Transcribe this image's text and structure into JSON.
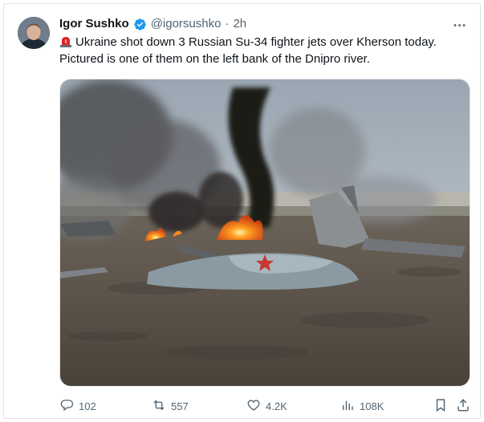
{
  "author": {
    "name": "Igor Sushko",
    "handle": "@igorsushko",
    "separator": "·",
    "time": "2h"
  },
  "icons": {
    "verified": "verified-badge-icon",
    "siren": "police-siren-emoji-icon",
    "more": "more-options-icon",
    "reply": "reply-icon",
    "repost": "repost-icon",
    "like": "like-icon",
    "views": "views-icon",
    "bookmark": "bookmark-icon",
    "share": "share-icon"
  },
  "tweet": {
    "line1": "Ukraine shot down 3 Russian Su-34 fighter jets over Kherson today.",
    "line2": "Pictured is one of them on the left bank of the Dnipro river."
  },
  "actions": {
    "replies": "102",
    "reposts": "557",
    "likes": "4.2K",
    "views": "108K"
  },
  "colors": {
    "verified": "#1d9bf0",
    "text": "#0f1419",
    "secondary": "#536471",
    "border": "#dfe3e6"
  }
}
